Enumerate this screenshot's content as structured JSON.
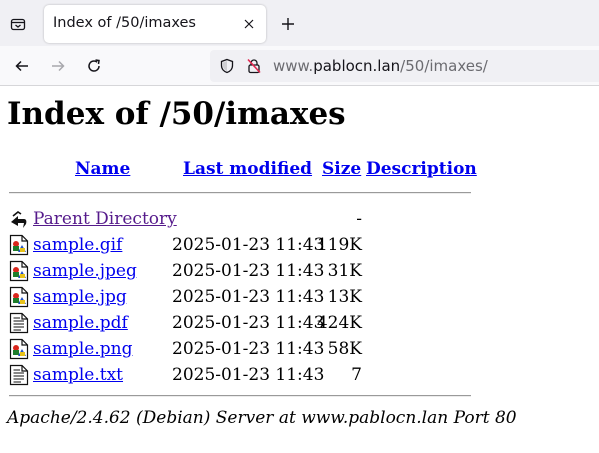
{
  "browser": {
    "tab_title": "Index of /50/imaxes",
    "url_scheme_prefix": "www.",
    "url_host": "pablocn.lan",
    "url_path": "/50/imaxes/",
    "icons": [
      "tab-list-icon",
      "close-icon",
      "plus-icon",
      "back-arrow-icon",
      "forward-arrow-icon",
      "reload-icon",
      "shield-icon",
      "insecure-lock-icon"
    ]
  },
  "page": {
    "title": "Index of /50/imaxes",
    "columns": {
      "name": "Name",
      "last_modified": "Last modified",
      "size": "Size",
      "description": "Description"
    },
    "parent": {
      "name": "Parent Directory",
      "size": "-",
      "icon": "back-folder-icon"
    },
    "files": [
      {
        "name": "sample.gif",
        "modified": "2025-01-23 11:43",
        "size": "119K",
        "icon": "image-file-icon"
      },
      {
        "name": "sample.jpeg",
        "modified": "2025-01-23 11:43",
        "size": "31K",
        "icon": "image-file-icon"
      },
      {
        "name": "sample.jpg",
        "modified": "2025-01-23 11:43",
        "size": "13K",
        "icon": "image-file-icon"
      },
      {
        "name": "sample.pdf",
        "modified": "2025-01-23 11:43",
        "size": "424K",
        "icon": "text-file-icon"
      },
      {
        "name": "sample.png",
        "modified": "2025-01-23 11:43",
        "size": "58K",
        "icon": "image-file-icon"
      },
      {
        "name": "sample.txt",
        "modified": "2025-01-23 11:43",
        "size": "7",
        "icon": "text-file-icon"
      }
    ],
    "footer": "Apache/2.4.62 (Debian) Server at www.pablocn.lan Port 80"
  },
  "colors": {
    "link": "#0000ee",
    "visited_link": "#551a8b",
    "tabstrip_bg": "#f0f0f4",
    "insecure_red": "#e22850"
  }
}
